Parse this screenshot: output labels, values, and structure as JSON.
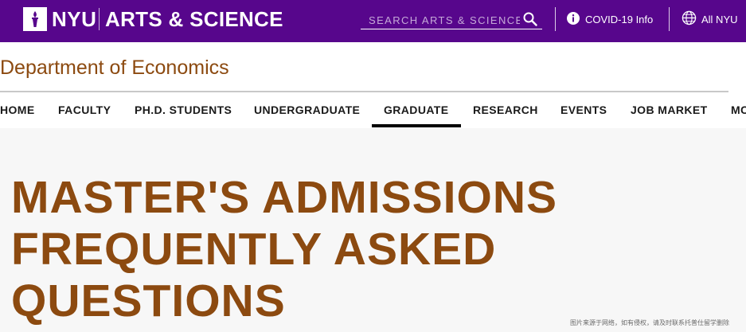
{
  "header": {
    "brand_short": "NYU",
    "brand_long": "ARTS & SCIENCE",
    "search_placeholder": "SEARCH ARTS & SCIENCE",
    "covid_link": "COVID-19 Info",
    "all_nyu_link": "All NYU",
    "bg_color": "#57068c"
  },
  "department": {
    "title": "Department of Economics",
    "color": "#8c4a10"
  },
  "nav": {
    "items": [
      {
        "label": "HOME"
      },
      {
        "label": "FACULTY"
      },
      {
        "label": "PH.D. STUDENTS"
      },
      {
        "label": "UNDERGRADUATE"
      },
      {
        "label": "GRADUATE",
        "active": true
      },
      {
        "label": "RESEARCH"
      },
      {
        "label": "EVENTS"
      },
      {
        "label": "JOB MARKET"
      },
      {
        "label": "MC"
      }
    ]
  },
  "page": {
    "heading_line1": "MASTER'S ADMISSIONS",
    "heading_line2": "FREQUENTLY ASKED",
    "heading_line3": "QUESTIONS"
  },
  "watermark": "图片来源于网络，如有侵权，请及时联系托普仕留学删除",
  "icons": {
    "logo": "nyu-torch-icon",
    "search": "search-icon",
    "info": "info-icon",
    "globe": "globe-icon"
  }
}
